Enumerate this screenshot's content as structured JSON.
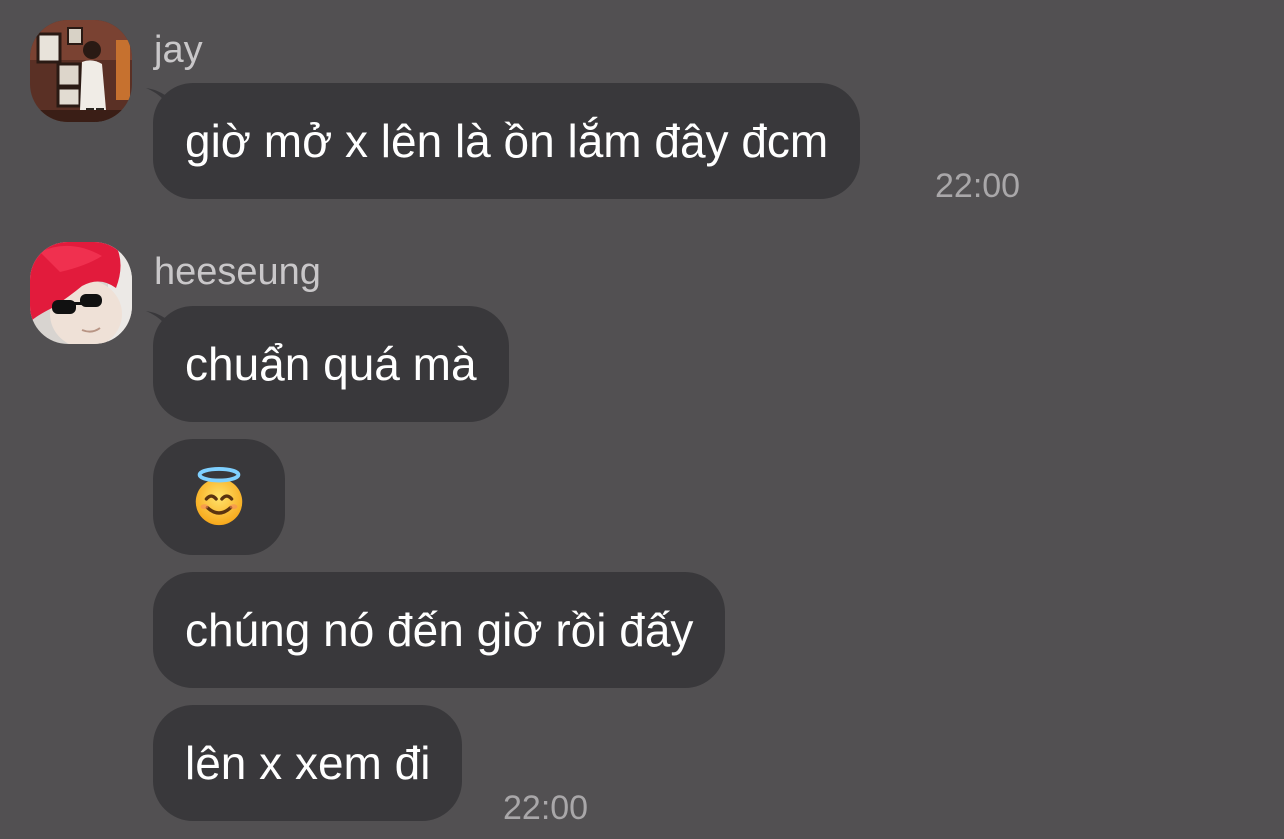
{
  "messages": [
    {
      "sender": "jay",
      "bubbles": [
        "giờ mở x lên là ồn lắm đây đcm"
      ],
      "time": "22:00"
    },
    {
      "sender": "heeseung",
      "bubbles": [
        "chuẩn quá mà",
        "smiling-face-with-halo",
        "chúng nó đến giờ rồi đấy",
        "lên x xem đi"
      ],
      "time": "22:00"
    }
  ]
}
